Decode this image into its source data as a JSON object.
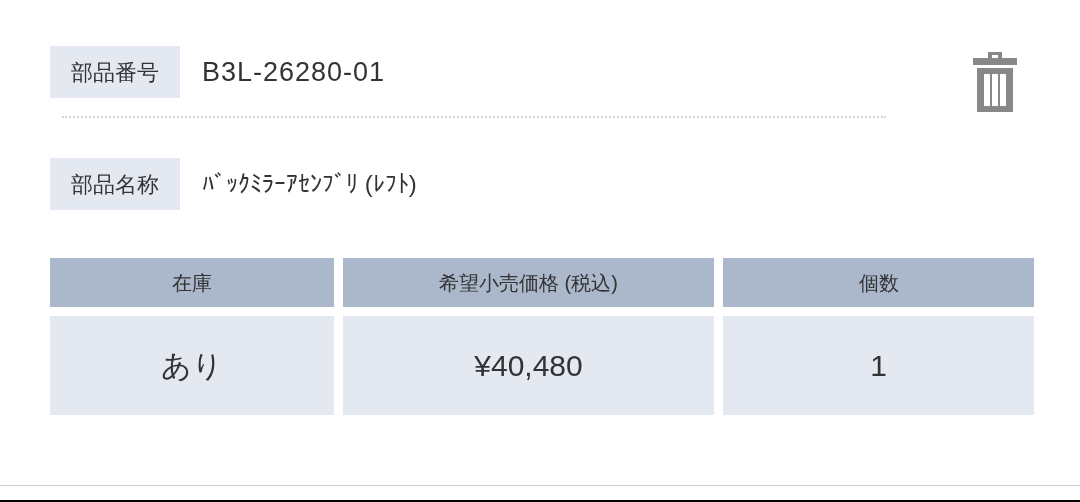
{
  "part_number": {
    "label": "部品番号",
    "value": "B3L-26280-01"
  },
  "part_name": {
    "label": "部品名称",
    "value": "ﾊﾞｯｸﾐﾗｰｱｾﾝﾌﾞﾘ (ﾚﾌﾄ)"
  },
  "table": {
    "columns": [
      "在庫",
      "希望小売価格 (税込)",
      "個数"
    ],
    "rows": [
      [
        "あり",
        "¥40,480",
        "1"
      ]
    ]
  }
}
